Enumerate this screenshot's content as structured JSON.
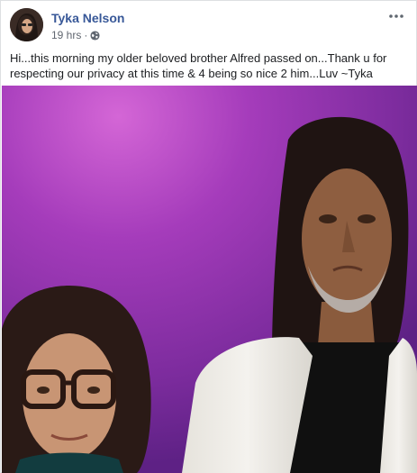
{
  "post": {
    "author": "Tyka Nelson",
    "timestamp": "19 hrs",
    "separator": "·",
    "privacy_icon": "globe-icon",
    "more_icon": "more-options-icon",
    "text": "Hi...this morning my older beloved brother Alfred passed on...Thank u for respecting our privacy at this time & 4 being so nice 2 him...Luv ~Tyka"
  },
  "colors": {
    "author_link": "#385898",
    "meta_text": "#616770",
    "photo_background": "#8a2fa8"
  }
}
